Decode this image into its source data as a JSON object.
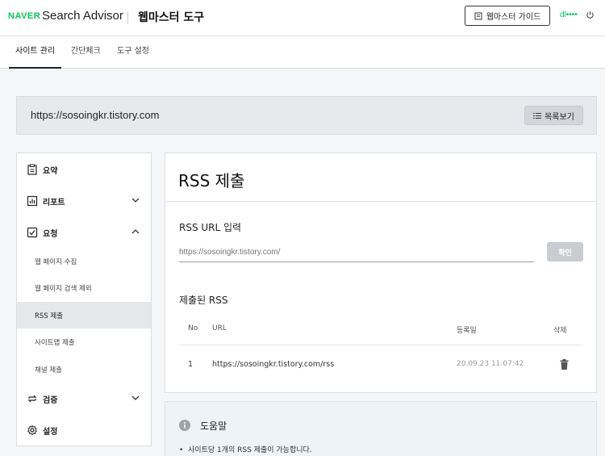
{
  "header": {
    "logo": "NAVER",
    "brand": "Search Advisor",
    "product": "웹마스터 도구",
    "guide_button": "웹마스터 가이드",
    "user": "dl••••",
    "icons": {
      "guide": "book-icon",
      "power": "power-icon"
    }
  },
  "tabs": [
    {
      "label": "사이트 관리",
      "active": true
    },
    {
      "label": "간단체크",
      "active": false
    },
    {
      "label": "도구 설정",
      "active": false
    }
  ],
  "site": {
    "url": "https://sosoingkr.tistory.com",
    "list_button": "목록보기"
  },
  "sidebar": {
    "items": [
      {
        "label": "요약",
        "icon": "clipboard-icon"
      },
      {
        "label": "리포트",
        "icon": "bar-chart-icon",
        "expandable": true,
        "expanded": false
      },
      {
        "label": "요청",
        "icon": "checkbox-icon",
        "expandable": true,
        "expanded": true
      },
      {
        "label": "검증",
        "icon": "swap-icon",
        "expandable": true,
        "expanded": false
      },
      {
        "label": "설정",
        "icon": "gear-icon"
      }
    ],
    "request_subitems": [
      {
        "label": "웹 페이지 수집",
        "active": false
      },
      {
        "label": "웹 페이지 검색 제외",
        "active": false
      },
      {
        "label": "RSS 제출",
        "active": true
      },
      {
        "label": "사이트맵 제출",
        "active": false
      },
      {
        "label": "채널 제출",
        "active": false
      }
    ]
  },
  "main": {
    "title": "RSS 제출",
    "input_label": "RSS URL 입력",
    "input_placeholder": "https://sosoingkr.tistory.com/",
    "confirm_button": "확인",
    "submitted_title": "제출된 RSS",
    "table": {
      "headers": [
        "No",
        "URL",
        "등록일",
        "삭제"
      ],
      "rows": [
        {
          "no": "1",
          "url": "https://sosoingkr.tistory.com/rss",
          "date": "20.09.23 11:07:42",
          "delete_icon": "trash-icon"
        }
      ]
    }
  },
  "help": {
    "title": "도움말",
    "icon": "info-icon",
    "bullets": [
      "사이트당 1개의 RSS 제출이 가능합니다."
    ]
  },
  "colors": {
    "naver_green": "#03c75a",
    "active_bg": "#e6e7e9",
    "sitebar_bg": "#e7e9ec",
    "help_bg": "#eef3f7"
  }
}
